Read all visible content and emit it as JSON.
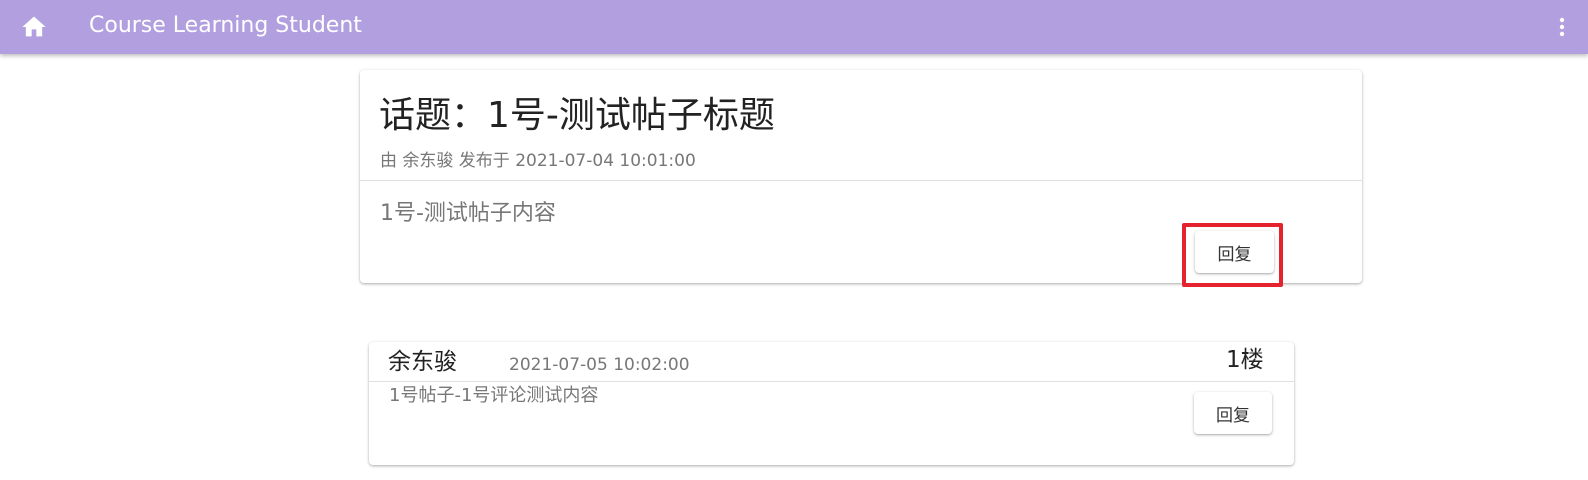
{
  "appbar": {
    "title": "Course Learning Student",
    "home_icon": "home-icon",
    "menu_icon": "more-vert-icon",
    "color": "#b19fdf"
  },
  "topic": {
    "title": "话题：1号-测试帖子标题",
    "meta": "由 余东骏 发布于 2021-07-04 10:01:00",
    "content": "1号-测试帖子内容",
    "reply_label": "回复"
  },
  "replies": [
    {
      "author": "余东骏",
      "time": "2021-07-05 10:02:00",
      "floor": "1楼",
      "content": "1号帖子-1号评论测试内容",
      "reply_label": "回复"
    }
  ],
  "highlight_color": "#e5232f"
}
